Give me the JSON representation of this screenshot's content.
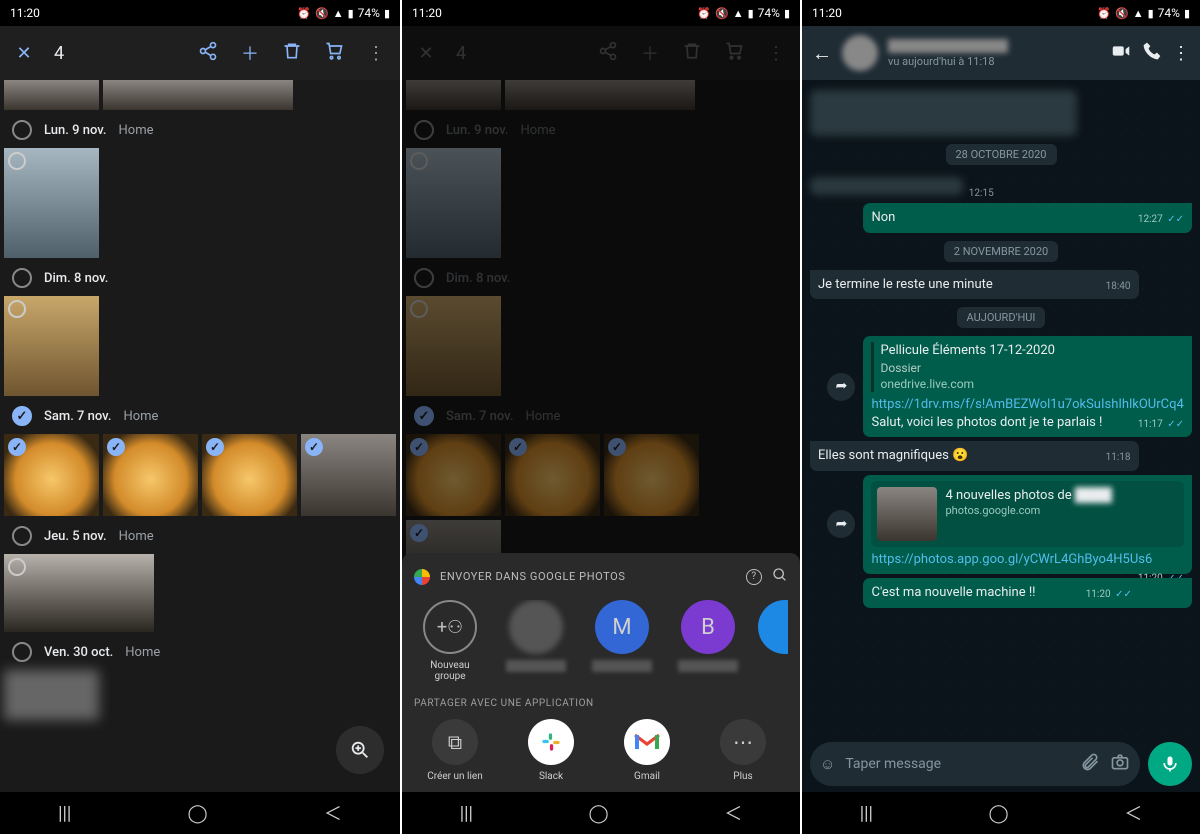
{
  "status": {
    "time": "11:20",
    "battery": "74%"
  },
  "gp": {
    "count": "4",
    "sections": [
      {
        "date": "Lun. 9 nov.",
        "loc": "Home"
      },
      {
        "date": "Dim. 8 nov.",
        "loc": ""
      },
      {
        "date": "Sam. 7 nov.",
        "loc": "Home"
      },
      {
        "date": "Jeu. 5 nov.",
        "loc": "Home"
      },
      {
        "date": "Ven. 30 oct.",
        "loc": "Home"
      }
    ]
  },
  "sheet": {
    "title": "ENVOYER DANS GOOGLE PHOTOS",
    "new_group": "Nouveau groupe",
    "contacts": [
      {
        "initial": "M"
      },
      {
        "initial": "B"
      }
    ],
    "share_with": "PARTAGER AVEC UNE APPLICATION",
    "apps": {
      "link": "Créer un lien",
      "slack": "Slack",
      "gmail": "Gmail",
      "more": "Plus"
    }
  },
  "wa": {
    "last_seen": "vu aujourd'hui à 11:18",
    "date1": "28 OCTOBRE 2020",
    "msg_in_blur_time": "12:15",
    "msg_non": "Non",
    "msg_non_time": "12:27",
    "date2": "2 NOVEMBRE 2020",
    "msg_reste": "Je termine le reste une minute",
    "msg_reste_time": "18:40",
    "date3": "AUJOURD'HUI",
    "card_title": "Pellicule Éléments 17-12-2020",
    "card_folder": "Dossier",
    "card_domain": "onedrive.live.com",
    "link1": "https://1drv.ms/f/s!AmBEZWol1u7okSuIshIhlkOUrCq4",
    "link1_suffix": " Salut, voici les photos dont je te parlais !",
    "link1_time": "11:17",
    "msg_magn": "Elles sont magnifiques 😮",
    "msg_magn_time": "11:18",
    "preview_title": "4 nouvelles photos de",
    "preview_domain": "photos.google.com",
    "link2": "https://photos.app.goo.gl/yCWrL4GhByo4H5Us6",
    "link2_time": "11:20",
    "msg_machine": "C'est ma nouvelle machine !!",
    "msg_machine_time": "11:20",
    "input_placeholder": "Taper message"
  }
}
